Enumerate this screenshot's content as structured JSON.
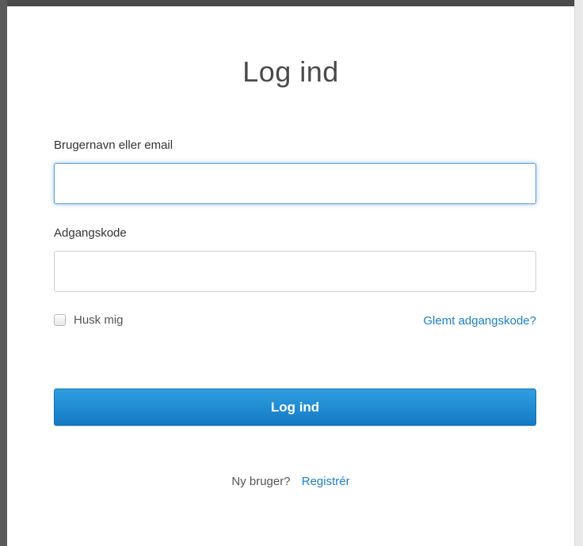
{
  "login_form": {
    "title": "Log ind",
    "username": {
      "label": "Brugernavn eller email",
      "value": "",
      "placeholder": ""
    },
    "password": {
      "label": "Adgangskode",
      "value": "",
      "placeholder": ""
    },
    "remember": {
      "label": "Husk mig",
      "checked": false
    },
    "forgot_password_label": "Glemt adgangskode?",
    "submit_label": "Log ind",
    "register_prompt": "Ny bruger?",
    "register_label": "Registrér"
  },
  "colors": {
    "accent": "#1a82c8",
    "button": "#1479c4",
    "focus_border": "#5b9dd9",
    "text": "#333333"
  }
}
